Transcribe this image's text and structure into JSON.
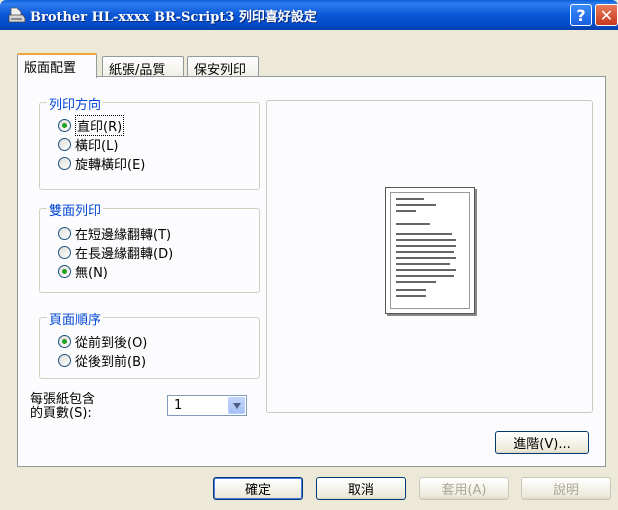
{
  "window": {
    "title": "Brother HL-xxxx BR-Script3 列印喜好設定",
    "help_label": "?",
    "close_label": "✕"
  },
  "tabs": [
    {
      "label": "版面配置",
      "active": true
    },
    {
      "label": "紙張/品質",
      "active": false
    },
    {
      "label": "保安列印",
      "active": false
    }
  ],
  "orientation": {
    "title": "列印方向",
    "options": [
      {
        "label": "直印(R)",
        "checked": true
      },
      {
        "label": "橫印(L)",
        "checked": false
      },
      {
        "label": "旋轉橫印(E)",
        "checked": false
      }
    ]
  },
  "duplex": {
    "title": "雙面列印",
    "options": [
      {
        "label": "在短邊緣翻轉(T)",
        "checked": false
      },
      {
        "label": "在長邊緣翻轉(D)",
        "checked": false
      },
      {
        "label": "無(N)",
        "checked": true
      }
    ]
  },
  "page_order": {
    "title": "頁面順序",
    "options": [
      {
        "label": "從前到後(O)",
        "checked": true
      },
      {
        "label": "從後到前(B)",
        "checked": false
      }
    ]
  },
  "pages_per_sheet": {
    "label_line1": "每張紙包含",
    "label_line2": "的頁數(S):",
    "value": "1"
  },
  "buttons": {
    "advanced": "進階(V)...",
    "ok": "確定",
    "cancel": "取消",
    "apply": "套用(A)",
    "help": "說明"
  },
  "colors": {
    "title_bar": "#0856d6",
    "group_title": "#0046d5",
    "radio_check": "#21a121",
    "active_tab_accent": "#f1a33c"
  },
  "icons": {
    "app": "printer-icon",
    "preview": "document-preview-icon"
  }
}
